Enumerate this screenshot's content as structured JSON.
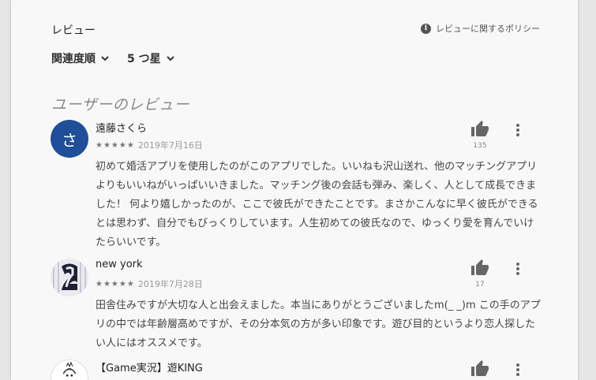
{
  "header": {
    "title": "レビュー",
    "policy_label": "レビューに関するポリシー"
  },
  "filters": {
    "sort_label": "関連度順",
    "rating_label": "5 つ星"
  },
  "section_title": "ユーザーのレビュー",
  "reviews": [
    {
      "author": "遠藤さくら",
      "avatar_initial": "さ",
      "stars": "★★★★★",
      "rating": 5,
      "date": "2019年7月16日",
      "helpful_count": "135",
      "text": "初めて婚活アプリを使用したのがこのアプリでした。いいねも沢山送れ、他のマッチングアプリよりもいいねがいっぱいいきました。マッチング後の会話も弾み、楽しく、人として成長できました！ 何より嬉しかったのが、ここで彼氏ができたことです。まさかこんなに早く彼氏ができるとは思わず、自分でもびっくりしています。人生初めての彼氏なので、ゆっくり愛を育んでいけたらいいです。"
    },
    {
      "author": "new york",
      "stars": "★★★★★",
      "rating": 5,
      "date": "2019年7月28日",
      "helpful_count": "17",
      "text": "田舎住みですが大切な人と出会えました。本当にありがとうございましたm(_ _)m この手のアプリの中では年齢層高めですが、その分本気の方が多い印象です。遊び目的というより恋人探したい人にはオススメです。"
    },
    {
      "author": "【Game実況】遊KING"
    }
  ],
  "colors": {
    "avatar_bg": "#1f4f99",
    "card_bg": "#f8f8f8"
  },
  "icons": [
    "info-icon",
    "chevron-down-icon",
    "thumbs-up-icon",
    "more-vert-icon"
  ]
}
